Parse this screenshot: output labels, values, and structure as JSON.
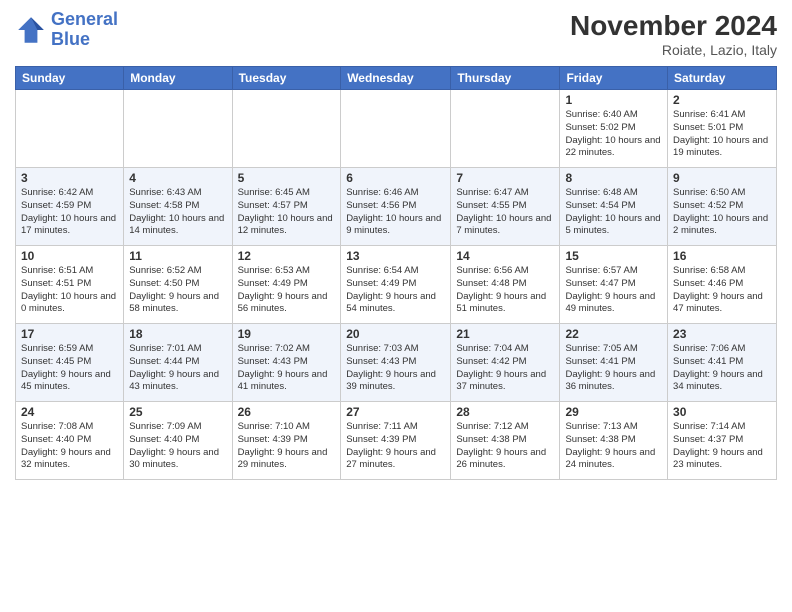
{
  "logo": {
    "line1": "General",
    "line2": "Blue"
  },
  "title": "November 2024",
  "location": "Roiate, Lazio, Italy",
  "days_of_week": [
    "Sunday",
    "Monday",
    "Tuesday",
    "Wednesday",
    "Thursday",
    "Friday",
    "Saturday"
  ],
  "weeks": [
    [
      {
        "day": "",
        "info": ""
      },
      {
        "day": "",
        "info": ""
      },
      {
        "day": "",
        "info": ""
      },
      {
        "day": "",
        "info": ""
      },
      {
        "day": "",
        "info": ""
      },
      {
        "day": "1",
        "info": "Sunrise: 6:40 AM\nSunset: 5:02 PM\nDaylight: 10 hours and 22 minutes."
      },
      {
        "day": "2",
        "info": "Sunrise: 6:41 AM\nSunset: 5:01 PM\nDaylight: 10 hours and 19 minutes."
      }
    ],
    [
      {
        "day": "3",
        "info": "Sunrise: 6:42 AM\nSunset: 4:59 PM\nDaylight: 10 hours and 17 minutes."
      },
      {
        "day": "4",
        "info": "Sunrise: 6:43 AM\nSunset: 4:58 PM\nDaylight: 10 hours and 14 minutes."
      },
      {
        "day": "5",
        "info": "Sunrise: 6:45 AM\nSunset: 4:57 PM\nDaylight: 10 hours and 12 minutes."
      },
      {
        "day": "6",
        "info": "Sunrise: 6:46 AM\nSunset: 4:56 PM\nDaylight: 10 hours and 9 minutes."
      },
      {
        "day": "7",
        "info": "Sunrise: 6:47 AM\nSunset: 4:55 PM\nDaylight: 10 hours and 7 minutes."
      },
      {
        "day": "8",
        "info": "Sunrise: 6:48 AM\nSunset: 4:54 PM\nDaylight: 10 hours and 5 minutes."
      },
      {
        "day": "9",
        "info": "Sunrise: 6:50 AM\nSunset: 4:52 PM\nDaylight: 10 hours and 2 minutes."
      }
    ],
    [
      {
        "day": "10",
        "info": "Sunrise: 6:51 AM\nSunset: 4:51 PM\nDaylight: 10 hours and 0 minutes."
      },
      {
        "day": "11",
        "info": "Sunrise: 6:52 AM\nSunset: 4:50 PM\nDaylight: 9 hours and 58 minutes."
      },
      {
        "day": "12",
        "info": "Sunrise: 6:53 AM\nSunset: 4:49 PM\nDaylight: 9 hours and 56 minutes."
      },
      {
        "day": "13",
        "info": "Sunrise: 6:54 AM\nSunset: 4:49 PM\nDaylight: 9 hours and 54 minutes."
      },
      {
        "day": "14",
        "info": "Sunrise: 6:56 AM\nSunset: 4:48 PM\nDaylight: 9 hours and 51 minutes."
      },
      {
        "day": "15",
        "info": "Sunrise: 6:57 AM\nSunset: 4:47 PM\nDaylight: 9 hours and 49 minutes."
      },
      {
        "day": "16",
        "info": "Sunrise: 6:58 AM\nSunset: 4:46 PM\nDaylight: 9 hours and 47 minutes."
      }
    ],
    [
      {
        "day": "17",
        "info": "Sunrise: 6:59 AM\nSunset: 4:45 PM\nDaylight: 9 hours and 45 minutes."
      },
      {
        "day": "18",
        "info": "Sunrise: 7:01 AM\nSunset: 4:44 PM\nDaylight: 9 hours and 43 minutes."
      },
      {
        "day": "19",
        "info": "Sunrise: 7:02 AM\nSunset: 4:43 PM\nDaylight: 9 hours and 41 minutes."
      },
      {
        "day": "20",
        "info": "Sunrise: 7:03 AM\nSunset: 4:43 PM\nDaylight: 9 hours and 39 minutes."
      },
      {
        "day": "21",
        "info": "Sunrise: 7:04 AM\nSunset: 4:42 PM\nDaylight: 9 hours and 37 minutes."
      },
      {
        "day": "22",
        "info": "Sunrise: 7:05 AM\nSunset: 4:41 PM\nDaylight: 9 hours and 36 minutes."
      },
      {
        "day": "23",
        "info": "Sunrise: 7:06 AM\nSunset: 4:41 PM\nDaylight: 9 hours and 34 minutes."
      }
    ],
    [
      {
        "day": "24",
        "info": "Sunrise: 7:08 AM\nSunset: 4:40 PM\nDaylight: 9 hours and 32 minutes."
      },
      {
        "day": "25",
        "info": "Sunrise: 7:09 AM\nSunset: 4:40 PM\nDaylight: 9 hours and 30 minutes."
      },
      {
        "day": "26",
        "info": "Sunrise: 7:10 AM\nSunset: 4:39 PM\nDaylight: 9 hours and 29 minutes."
      },
      {
        "day": "27",
        "info": "Sunrise: 7:11 AM\nSunset: 4:39 PM\nDaylight: 9 hours and 27 minutes."
      },
      {
        "day": "28",
        "info": "Sunrise: 7:12 AM\nSunset: 4:38 PM\nDaylight: 9 hours and 26 minutes."
      },
      {
        "day": "29",
        "info": "Sunrise: 7:13 AM\nSunset: 4:38 PM\nDaylight: 9 hours and 24 minutes."
      },
      {
        "day": "30",
        "info": "Sunrise: 7:14 AM\nSunset: 4:37 PM\nDaylight: 9 hours and 23 minutes."
      }
    ]
  ]
}
